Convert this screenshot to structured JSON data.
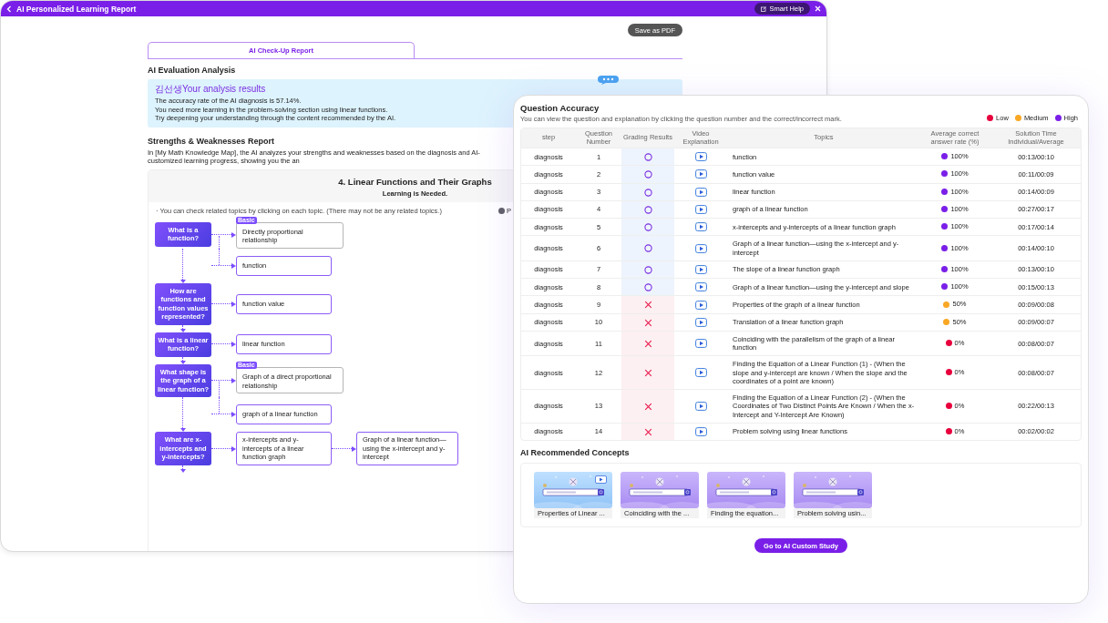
{
  "report": {
    "title": "AI Personalized Learning Report",
    "help_button": "Smart Help",
    "save_button": "Save as PDF",
    "tabs": [
      {
        "label": "AI Check-Up Report",
        "selected": true
      }
    ],
    "evaluation": {
      "heading": "AI Evaluation Analysis",
      "result_title": "김선생Your analysis results",
      "lines": [
        "The accuracy rate of the AI diagnosis is 57.14%.",
        "You need more learning in the problem-solving section using linear functions.",
        "Try deepening your understanding through the content recommended by the AI."
      ]
    },
    "strengths": {
      "heading": "Strengths & Weaknesses Report",
      "description": "In [My Math Knowledge Map], the AI analyzes your strengths and weaknesses based on the diagnosis and AI-customized learning progress, showing you the an",
      "card": {
        "title": "4. Linear Functions and Their Graphs",
        "subtitle": "Learning is Needed.",
        "note": "· You can check related topics by clicking on each topic. (There may not be any related topics.)",
        "legend": [
          {
            "label": "P",
            "color": "#5f5f66"
          }
        ]
      },
      "flow": [
        {
          "question": "What is a function?",
          "topics": [
            {
              "label": "Directly proportional relationship",
              "kind": "basic",
              "tag": "Basic"
            },
            {
              "label": "function",
              "kind": "topic"
            }
          ]
        },
        {
          "question": "How are functions and function values represented?",
          "topics": [
            {
              "label": "function value",
              "kind": "topic"
            }
          ]
        },
        {
          "question": "What is a linear function?",
          "topics": [
            {
              "label": "linear function",
              "kind": "topic"
            }
          ]
        },
        {
          "question": "What shape is the graph of a linear function?",
          "topics": [
            {
              "label": "Graph of a direct proportional relationship",
              "kind": "basic",
              "tag": "Basic"
            },
            {
              "label": "graph of a linear function",
              "kind": "topic"
            }
          ]
        },
        {
          "question": "What are x-intercepts and y-intercepts?",
          "topics": [
            {
              "label": "x-intercepts and y-intercepts of a linear function graph",
              "kind": "topic",
              "next": {
                "label": "Graph of a linear function—using the x-intercept and y-intercept"
              }
            }
          ]
        }
      ]
    }
  },
  "accuracy": {
    "title": "Question Accuracy",
    "subtitle": "You can view the question and explanation by clicking the question number and the correct/incorrect mark.",
    "legend": [
      {
        "label": "Low",
        "color": "#e8003d"
      },
      {
        "label": "Medium",
        "color": "#f9a825"
      },
      {
        "label": "High",
        "color": "#7a1fe8"
      }
    ],
    "columns": [
      "step",
      "Question Number",
      "Grading Results",
      "Video Explanation",
      "Topics",
      "Average correct answer rate (%)",
      "Solution Time\nIndividual/Average"
    ],
    "rows": [
      {
        "step": "diagnosis",
        "number": "1",
        "correct": true,
        "topic": "function",
        "color": "#7a1fe8",
        "rate": "100%",
        "time": "00:13/00:10"
      },
      {
        "step": "diagnosis",
        "number": "2",
        "correct": true,
        "topic": "function value",
        "color": "#7a1fe8",
        "rate": "100%",
        "time": "00:11/00:09"
      },
      {
        "step": "diagnosis",
        "number": "3",
        "correct": true,
        "topic": "linear function",
        "color": "#7a1fe8",
        "rate": "100%",
        "time": "00:14/00:09"
      },
      {
        "step": "diagnosis",
        "number": "4",
        "correct": true,
        "topic": "graph of a linear function",
        "color": "#7a1fe8",
        "rate": "100%",
        "time": "00:27/00:17"
      },
      {
        "step": "diagnosis",
        "number": "5",
        "correct": true,
        "topic": "x-intercepts and y-intercepts of a linear function graph",
        "color": "#7a1fe8",
        "rate": "100%",
        "time": "00:17/00:14"
      },
      {
        "step": "diagnosis",
        "number": "6",
        "correct": true,
        "topic": "Graph of a linear function—using the x-intercept and y-intercept",
        "color": "#7a1fe8",
        "rate": "100%",
        "time": "00:14/00:10"
      },
      {
        "step": "diagnosis",
        "number": "7",
        "correct": true,
        "topic": "The slope of a linear function graph",
        "color": "#7a1fe8",
        "rate": "100%",
        "time": "00:13/00:10"
      },
      {
        "step": "diagnosis",
        "number": "8",
        "correct": true,
        "topic": "Graph of a linear function—using the y-intercept and slope",
        "color": "#7a1fe8",
        "rate": "100%",
        "time": "00:15/00:13"
      },
      {
        "step": "diagnosis",
        "number": "9",
        "correct": false,
        "topic": "Properties of the graph of a linear function",
        "color": "#f9a825",
        "rate": "50%",
        "time": "00:09/00:08"
      },
      {
        "step": "diagnosis",
        "number": "10",
        "correct": false,
        "topic": "Translation of a linear function graph",
        "color": "#f9a825",
        "rate": "50%",
        "time": "00:09/00:07"
      },
      {
        "step": "diagnosis",
        "number": "11",
        "correct": false,
        "topic": "Coinciding with the parallelism of the graph of a linear function",
        "color": "#e8003d",
        "rate": "0%",
        "time": "00:08/00:07"
      },
      {
        "step": "diagnosis",
        "number": "12",
        "correct": false,
        "topic": "Finding the Equation of a Linear Function (1) - (When the slope and y-intercept are known / When the slope and the coordinates of a point are known)",
        "color": "#e8003d",
        "rate": "0%",
        "time": "00:08/00:07"
      },
      {
        "step": "diagnosis",
        "number": "13",
        "correct": false,
        "topic": "Finding the Equation of a Linear Function (2) - (When the Coordinates of Two Distinct Points Are Known / When the x-Intercept and Y-Intercept Are Known)",
        "color": "#e8003d",
        "rate": "0%",
        "time": "00:22/00:13"
      },
      {
        "step": "diagnosis",
        "number": "14",
        "correct": false,
        "topic": "Problem solving using linear functions",
        "color": "#e8003d",
        "rate": "0%",
        "time": "00:02/00:02"
      }
    ],
    "recommended": {
      "heading": "AI Recommended Concepts",
      "items": [
        {
          "caption": "Properties of Linear ...",
          "video": true
        },
        {
          "caption": "Coinciding with the ...",
          "video": false
        },
        {
          "caption": "Finding the equation...",
          "video": false
        },
        {
          "caption": "Problem solving usin...",
          "video": false
        }
      ]
    },
    "button": "Go to AI Custom Study"
  }
}
